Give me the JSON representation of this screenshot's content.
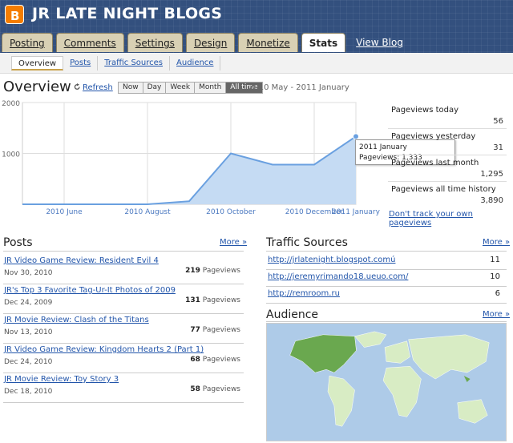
{
  "header": {
    "title": "JR LATE NIGHT BLOGS",
    "logo_letter": "B"
  },
  "tabs": [
    {
      "label": "Posting",
      "active": false
    },
    {
      "label": "Comments",
      "active": false
    },
    {
      "label": "Settings",
      "active": false
    },
    {
      "label": "Design",
      "active": false
    },
    {
      "label": "Monetize",
      "active": false
    },
    {
      "label": "Stats",
      "active": true
    }
  ],
  "view_blog": "View Blog",
  "subtabs": [
    {
      "label": "Overview",
      "active": true
    },
    {
      "label": "Posts",
      "active": false
    },
    {
      "label": "Traffic Sources",
      "active": false
    },
    {
      "label": "Audience",
      "active": false
    }
  ],
  "overview": {
    "title": "Overview",
    "refresh": "Refresh",
    "ranges": [
      "Now",
      "Day",
      "Week",
      "Month",
      "All time"
    ],
    "active_range": "All time",
    "date_range": "2010 May - 2011 January"
  },
  "chart_data": {
    "type": "area",
    "x": [
      "2010 May",
      "2010 June",
      "2010 July",
      "2010 August",
      "2010 September",
      "2010 October",
      "2010 November",
      "2010 December",
      "2011 January"
    ],
    "x_tick_labels": [
      "2010 June",
      "2010 August",
      "2010 October",
      "2010 December",
      "2011 January"
    ],
    "y_ticks": [
      "2000",
      "1000"
    ],
    "series": [
      {
        "values": [
          0,
          0,
          0,
          0,
          60,
          1000,
          780,
          780,
          1333
        ]
      }
    ],
    "ylim": [
      0,
      2000
    ],
    "grid": true,
    "color": "#6aa0e0",
    "fill": "#c5dbf3",
    "tooltip": {
      "label": "2011 January",
      "value": "Pageviews: 1,333"
    }
  },
  "stats": [
    {
      "label": "Pageviews today",
      "value": "56"
    },
    {
      "label": "Pageviews yesterday",
      "value": "31"
    },
    {
      "label": "Pageviews last month",
      "value": "1,295"
    },
    {
      "label": "Pageviews all time history",
      "value": "3,890"
    }
  ],
  "dont_track": "Don't track your own pageviews",
  "posts": {
    "title": "Posts",
    "more": "More »",
    "items": [
      {
        "title": "JR Video Game Review: Resident Evil 4",
        "date": "Nov 30, 2010",
        "views": "219",
        "unit": "Pageviews"
      },
      {
        "title": "JR's Top 3 Favorite Tag-Ur-It Photos of 2009",
        "date": "Dec 24, 2009",
        "views": "131",
        "unit": "Pageviews"
      },
      {
        "title": "JR Movie Review: Clash of the Titans",
        "date": "Nov 13, 2010",
        "views": "77",
        "unit": "Pageviews"
      },
      {
        "title": "JR Video Game Review: Kingdom Hearts 2 (Part 1)",
        "date": "Dec 24, 2010",
        "views": "68",
        "unit": "Pageviews"
      },
      {
        "title": "JR Movie Review: Toy Story 3",
        "date": "Dec 18, 2010",
        "views": "58",
        "unit": "Pageviews"
      }
    ]
  },
  "traffic": {
    "title": "Traffic Sources",
    "more": "More »",
    "items": [
      {
        "url": "http://jrlatenight.blogspot.comú",
        "count": "11"
      },
      {
        "url": "http://jeremyrimando18.ueuo.com/",
        "count": "10"
      },
      {
        "url": "http://remroom.ru",
        "count": "6"
      }
    ]
  },
  "audience": {
    "title": "Audience",
    "more": "More »"
  },
  "colors": {
    "header": "#33507e",
    "link": "#2255aa",
    "map_water": "#aecbe8",
    "map_land": "#d8ecc4",
    "map_highlight": "#6aa84f"
  }
}
